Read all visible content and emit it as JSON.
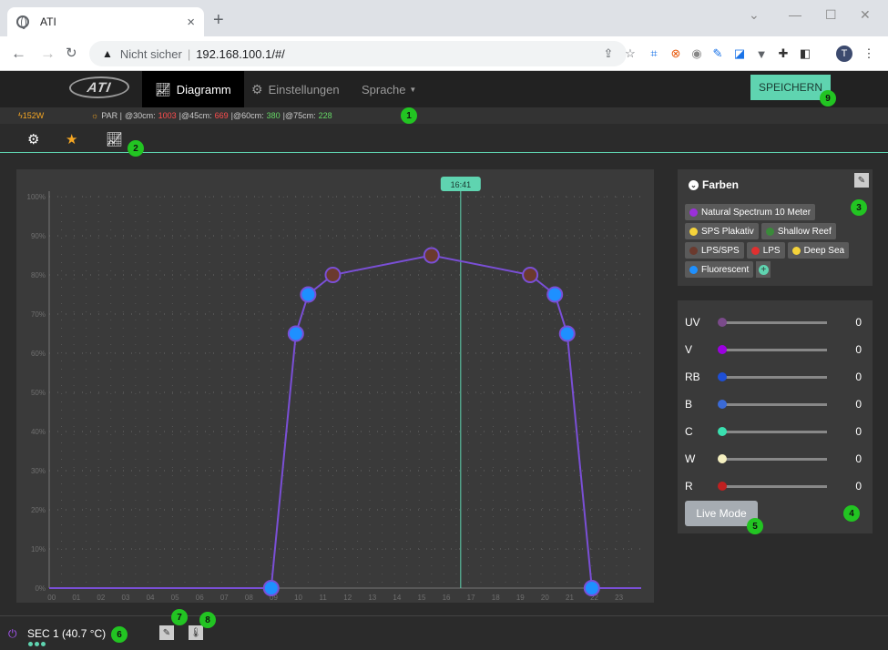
{
  "browser": {
    "tab_title": "ATI",
    "tab_close": "×",
    "new_tab": "+",
    "url_warning": "Nicht sicher",
    "url_separator": "|",
    "url": "192.168.100.1/#/",
    "avatar_letter": "T"
  },
  "nav": {
    "logo": "ATI",
    "items": [
      {
        "label": "Diagramm",
        "active": true
      },
      {
        "label": "Einstellungen",
        "active": false
      },
      {
        "label": "Sprache",
        "active": false
      }
    ],
    "save_label": "SPEICHERN"
  },
  "status": {
    "watt": "152W",
    "par_label": "PAR |",
    "readings": [
      {
        "label": "@30cm:",
        "value": "1003",
        "color": "#ff4d4d"
      },
      {
        "label": "|@45cm:",
        "value": "669",
        "color": "#ff4d4d"
      },
      {
        "label": "|@60cm:",
        "value": "380",
        "color": "#66d966"
      },
      {
        "label": "|@75cm:",
        "value": "228",
        "color": "#66d966"
      }
    ]
  },
  "chart_data": {
    "type": "line",
    "current_time": "16:41",
    "current_time_hour": 16.683,
    "x_ticks": [
      "00",
      "01",
      "02",
      "03",
      "04",
      "05",
      "06",
      "07",
      "08",
      "09",
      "10",
      "11",
      "12",
      "13",
      "14",
      "15",
      "16",
      "17",
      "18",
      "19",
      "20",
      "21",
      "22",
      "23"
    ],
    "y_ticks": [
      "0%",
      "10%",
      "20%",
      "30%",
      "40%",
      "50%",
      "60%",
      "70%",
      "80%",
      "90%",
      "100%"
    ],
    "ylim": [
      0,
      100
    ],
    "xlim": [
      0,
      24
    ],
    "line_color": "#7a4fd6",
    "points": [
      {
        "x": 0,
        "y": 0,
        "marker": false
      },
      {
        "x": 9,
        "y": 0,
        "marker": true,
        "color": "#1e90ff"
      },
      {
        "x": 10,
        "y": 65,
        "marker": true,
        "color": "#1e90ff"
      },
      {
        "x": 10.5,
        "y": 75,
        "marker": true,
        "color": "#1e90ff"
      },
      {
        "x": 11.5,
        "y": 80,
        "marker": true,
        "color": "#6b3a2e"
      },
      {
        "x": 15.5,
        "y": 85,
        "marker": true,
        "color": "#6b3a2e"
      },
      {
        "x": 19.5,
        "y": 80,
        "marker": true,
        "color": "#6b3a2e"
      },
      {
        "x": 20.5,
        "y": 75,
        "marker": true,
        "color": "#1e90ff"
      },
      {
        "x": 21,
        "y": 65,
        "marker": true,
        "color": "#1e90ff"
      },
      {
        "x": 22,
        "y": 0,
        "marker": true,
        "color": "#1e90ff"
      },
      {
        "x": 24,
        "y": 0,
        "marker": false
      }
    ]
  },
  "farben": {
    "title": "Farben",
    "presets": [
      {
        "label": "Natural Spectrum 10 Meter",
        "color": "#9b30d9"
      },
      {
        "label": "SPS Plakativ",
        "color": "#f5d33a"
      },
      {
        "label": "Shallow Reef",
        "color": "#3a8a3a"
      },
      {
        "label": "LPS/SPS",
        "color": "#6b3a2e"
      },
      {
        "label": "LPS",
        "color": "#e03030"
      },
      {
        "label": "Deep Sea",
        "color": "#f5d33a"
      },
      {
        "label": "Fluorescent",
        "color": "#1e90ff"
      }
    ]
  },
  "channels": {
    "items": [
      {
        "name": "UV",
        "value": "0",
        "color": "#7a4a8a"
      },
      {
        "name": "V",
        "value": "0",
        "color": "#9b00e0"
      },
      {
        "name": "RB",
        "value": "0",
        "color": "#1e4fd6"
      },
      {
        "name": "B",
        "value": "0",
        "color": "#3a6ad6"
      },
      {
        "name": "C",
        "value": "0",
        "color": "#3ae0b0"
      },
      {
        "name": "W",
        "value": "0",
        "color": "#f5f0c0"
      },
      {
        "name": "R",
        "value": "0",
        "color": "#c02020"
      }
    ],
    "live_mode_label": "Live Mode"
  },
  "footer": {
    "sec_label": "SEC 1 (40.7 °C)"
  },
  "markers": [
    "1",
    "2",
    "3",
    "4",
    "5",
    "6",
    "7",
    "8",
    "9"
  ]
}
